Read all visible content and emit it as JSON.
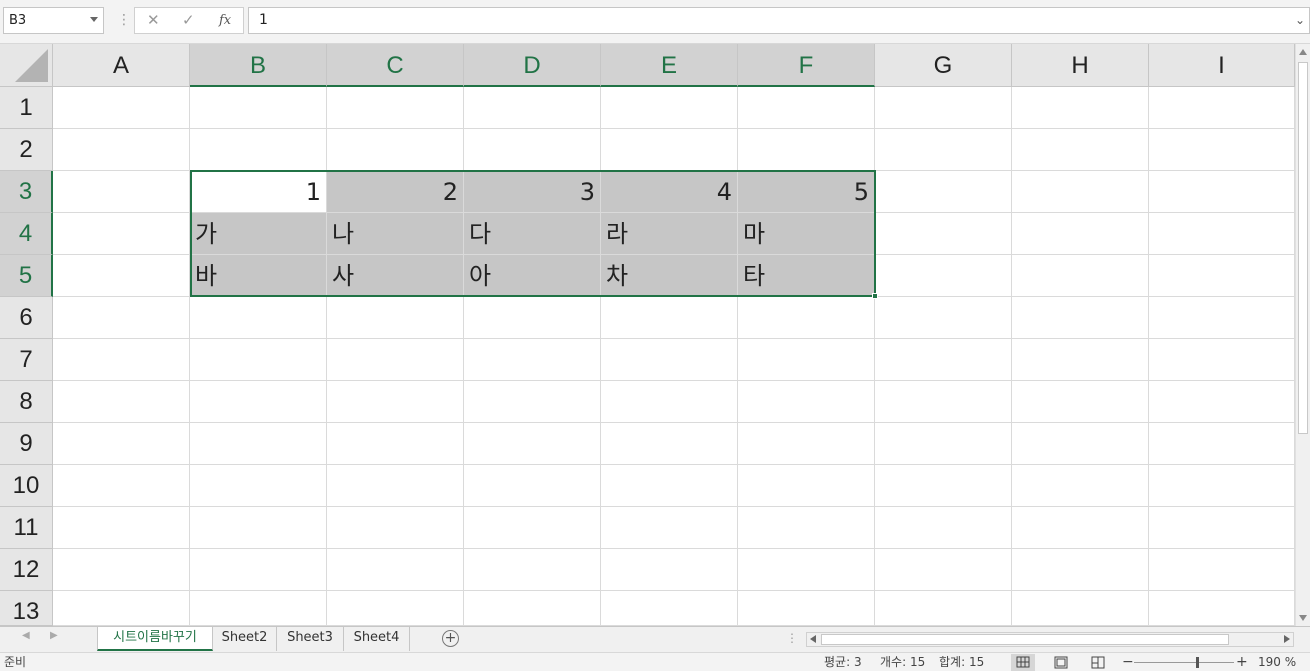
{
  "formula_bar": {
    "name_box": "B3",
    "cancel_icon": "✕",
    "enter_icon": "✓",
    "fx_label": "fx",
    "formula": "1"
  },
  "columns": [
    "A",
    "B",
    "C",
    "D",
    "E",
    "F",
    "G",
    "H",
    "I"
  ],
  "selected_columns": [
    "B",
    "C",
    "D",
    "E",
    "F"
  ],
  "rows": [
    "1",
    "2",
    "3",
    "4",
    "5",
    "6",
    "7",
    "8",
    "9",
    "10",
    "11",
    "12",
    "13"
  ],
  "selected_rows": [
    "3",
    "4",
    "5"
  ],
  "cells": {
    "B3": "1",
    "C3": "2",
    "D3": "3",
    "E3": "4",
    "F3": "5",
    "B4": "가",
    "C4": "나",
    "D4": "다",
    "E4": "라",
    "F4": "마",
    "B5": "바",
    "C5": "사",
    "D5": "아",
    "E5": "차",
    "F5": "타"
  },
  "active_cell": "B3",
  "sheet_tabs": [
    {
      "label": "시트이름바꾸기",
      "active": true
    },
    {
      "label": "Sheet2",
      "active": false
    },
    {
      "label": "Sheet3",
      "active": false
    },
    {
      "label": "Sheet4",
      "active": false
    }
  ],
  "status_bar": {
    "ready": "준비",
    "average": "평균: 3",
    "count": "개수: 15",
    "sum": "합계: 15",
    "zoom": "190 %"
  },
  "colors": {
    "accent": "#217346",
    "selection_fill": "#c6c6c6",
    "header_bg": "#e6e6e6"
  },
  "icons": {
    "cancel": "close-icon",
    "enter": "check-icon",
    "function": "fx-icon",
    "add_sheet": "plus-circle-icon",
    "normal_view": "grid-icon",
    "page_layout": "page-layout-icon",
    "page_break": "page-break-icon"
  }
}
